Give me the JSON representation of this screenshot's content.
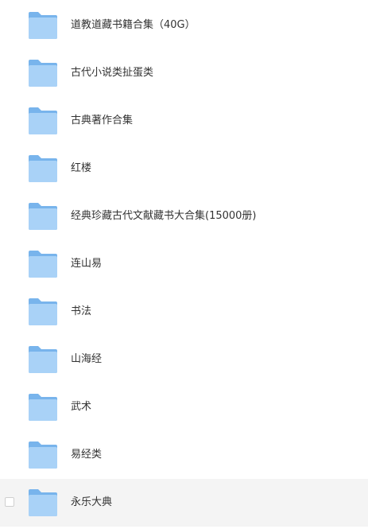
{
  "files": [
    {
      "name": "道教道藏书籍合集（40G）",
      "icon": "folder-icon"
    },
    {
      "name": "古代小说类扯蛋类",
      "icon": "folder-icon"
    },
    {
      "name": "古典著作合集",
      "icon": "folder-icon"
    },
    {
      "name": "红楼",
      "icon": "folder-icon"
    },
    {
      "name": "经典珍藏古代文献藏书大合集(15000册)",
      "icon": "folder-icon"
    },
    {
      "name": "连山易",
      "icon": "folder-icon"
    },
    {
      "name": "书法",
      "icon": "folder-icon"
    },
    {
      "name": "山海经",
      "icon": "folder-icon"
    },
    {
      "name": "武术",
      "icon": "folder-icon"
    },
    {
      "name": "易经类",
      "icon": "folder-icon"
    },
    {
      "name": "永乐大典",
      "icon": "folder-icon"
    }
  ],
  "colors": {
    "folder_back": "#78b4ec",
    "folder_front": "#a9d2f7",
    "hover_row": "#f4f4f4",
    "text": "#333333"
  }
}
